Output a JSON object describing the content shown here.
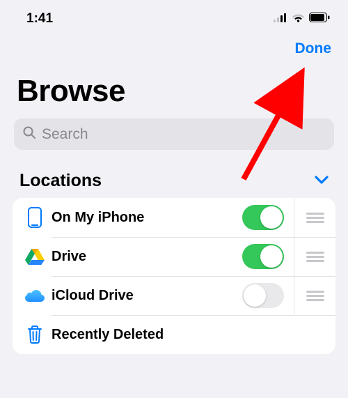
{
  "status": {
    "time": "1:41"
  },
  "nav": {
    "done": "Done"
  },
  "title": "Browse",
  "search": {
    "placeholder": "Search"
  },
  "section": {
    "title": "Locations"
  },
  "rows": [
    {
      "icon": "iphone",
      "label": "On My iPhone",
      "toggle": "on",
      "reorderable": true
    },
    {
      "icon": "gdrive",
      "label": "Drive",
      "toggle": "on",
      "reorderable": true
    },
    {
      "icon": "icloud",
      "label": "iCloud Drive",
      "toggle": "off",
      "reorderable": true
    },
    {
      "icon": "trash",
      "label": "Recently Deleted",
      "toggle": null,
      "reorderable": false
    }
  ]
}
